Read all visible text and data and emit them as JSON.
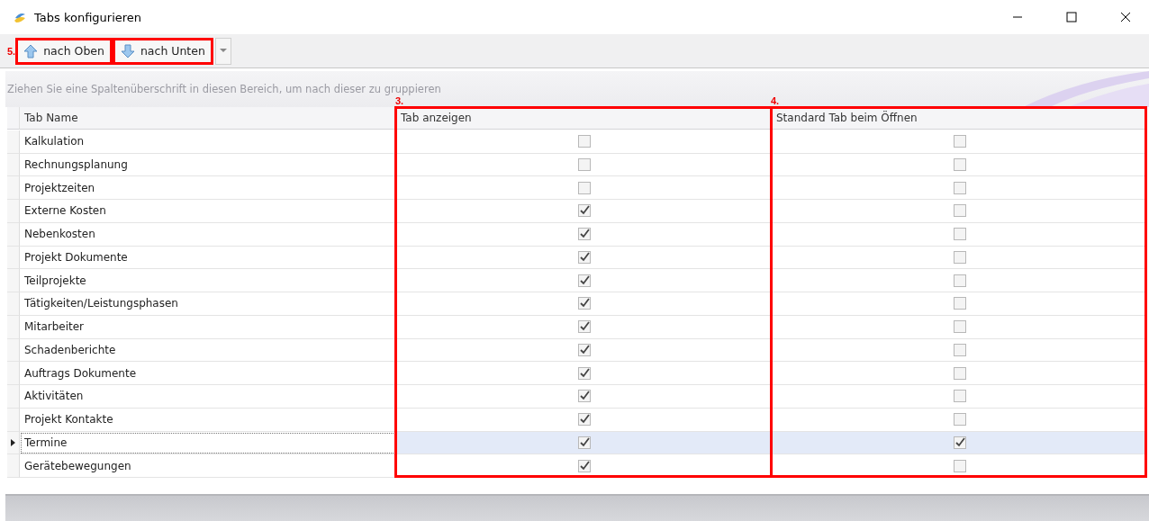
{
  "window": {
    "title": "Tabs konfigurieren"
  },
  "toolbar": {
    "marker": "5.",
    "buttons": [
      {
        "label": "nach Oben",
        "kind": "up",
        "highlighted": true
      },
      {
        "label": "nach Unten",
        "kind": "down",
        "highlighted": true
      }
    ]
  },
  "group_panel": {
    "placeholder": "Ziehen Sie eine Spaltenüberschrift in diesen Bereich, um nach dieser zu gruppieren"
  },
  "table": {
    "columns": [
      {
        "label": "Tab Name",
        "highlighted": false
      },
      {
        "label": "Tab anzeigen",
        "highlighted": true,
        "marker": "3."
      },
      {
        "label": "Standard Tab beim Öffnen",
        "highlighted": true,
        "marker": "4."
      }
    ],
    "rows": [
      {
        "name": "Kalkulation",
        "show": false,
        "default": false,
        "selected": false
      },
      {
        "name": "Rechnungsplanung",
        "show": false,
        "default": false,
        "selected": false
      },
      {
        "name": "Projektzeiten",
        "show": false,
        "default": false,
        "selected": false
      },
      {
        "name": "Externe Kosten",
        "show": true,
        "default": false,
        "selected": false
      },
      {
        "name": "Nebenkosten",
        "show": true,
        "default": false,
        "selected": false
      },
      {
        "name": "Projekt Dokumente",
        "show": true,
        "default": false,
        "selected": false
      },
      {
        "name": "Teilprojekte",
        "show": true,
        "default": false,
        "selected": false
      },
      {
        "name": "Tätigkeiten/Leistungsphasen",
        "show": true,
        "default": false,
        "selected": false
      },
      {
        "name": "Mitarbeiter",
        "show": true,
        "default": false,
        "selected": false
      },
      {
        "name": "Schadenberichte",
        "show": true,
        "default": false,
        "selected": false
      },
      {
        "name": "Auftrags Dokumente",
        "show": true,
        "default": false,
        "selected": false
      },
      {
        "name": "Aktivitäten",
        "show": true,
        "default": false,
        "selected": false
      },
      {
        "name": "Projekt Kontakte",
        "show": true,
        "default": false,
        "selected": false
      },
      {
        "name": "Termine",
        "show": true,
        "default": true,
        "selected": true
      },
      {
        "name": "Gerätebewegungen",
        "show": true,
        "default": false,
        "selected": false
      }
    ]
  }
}
